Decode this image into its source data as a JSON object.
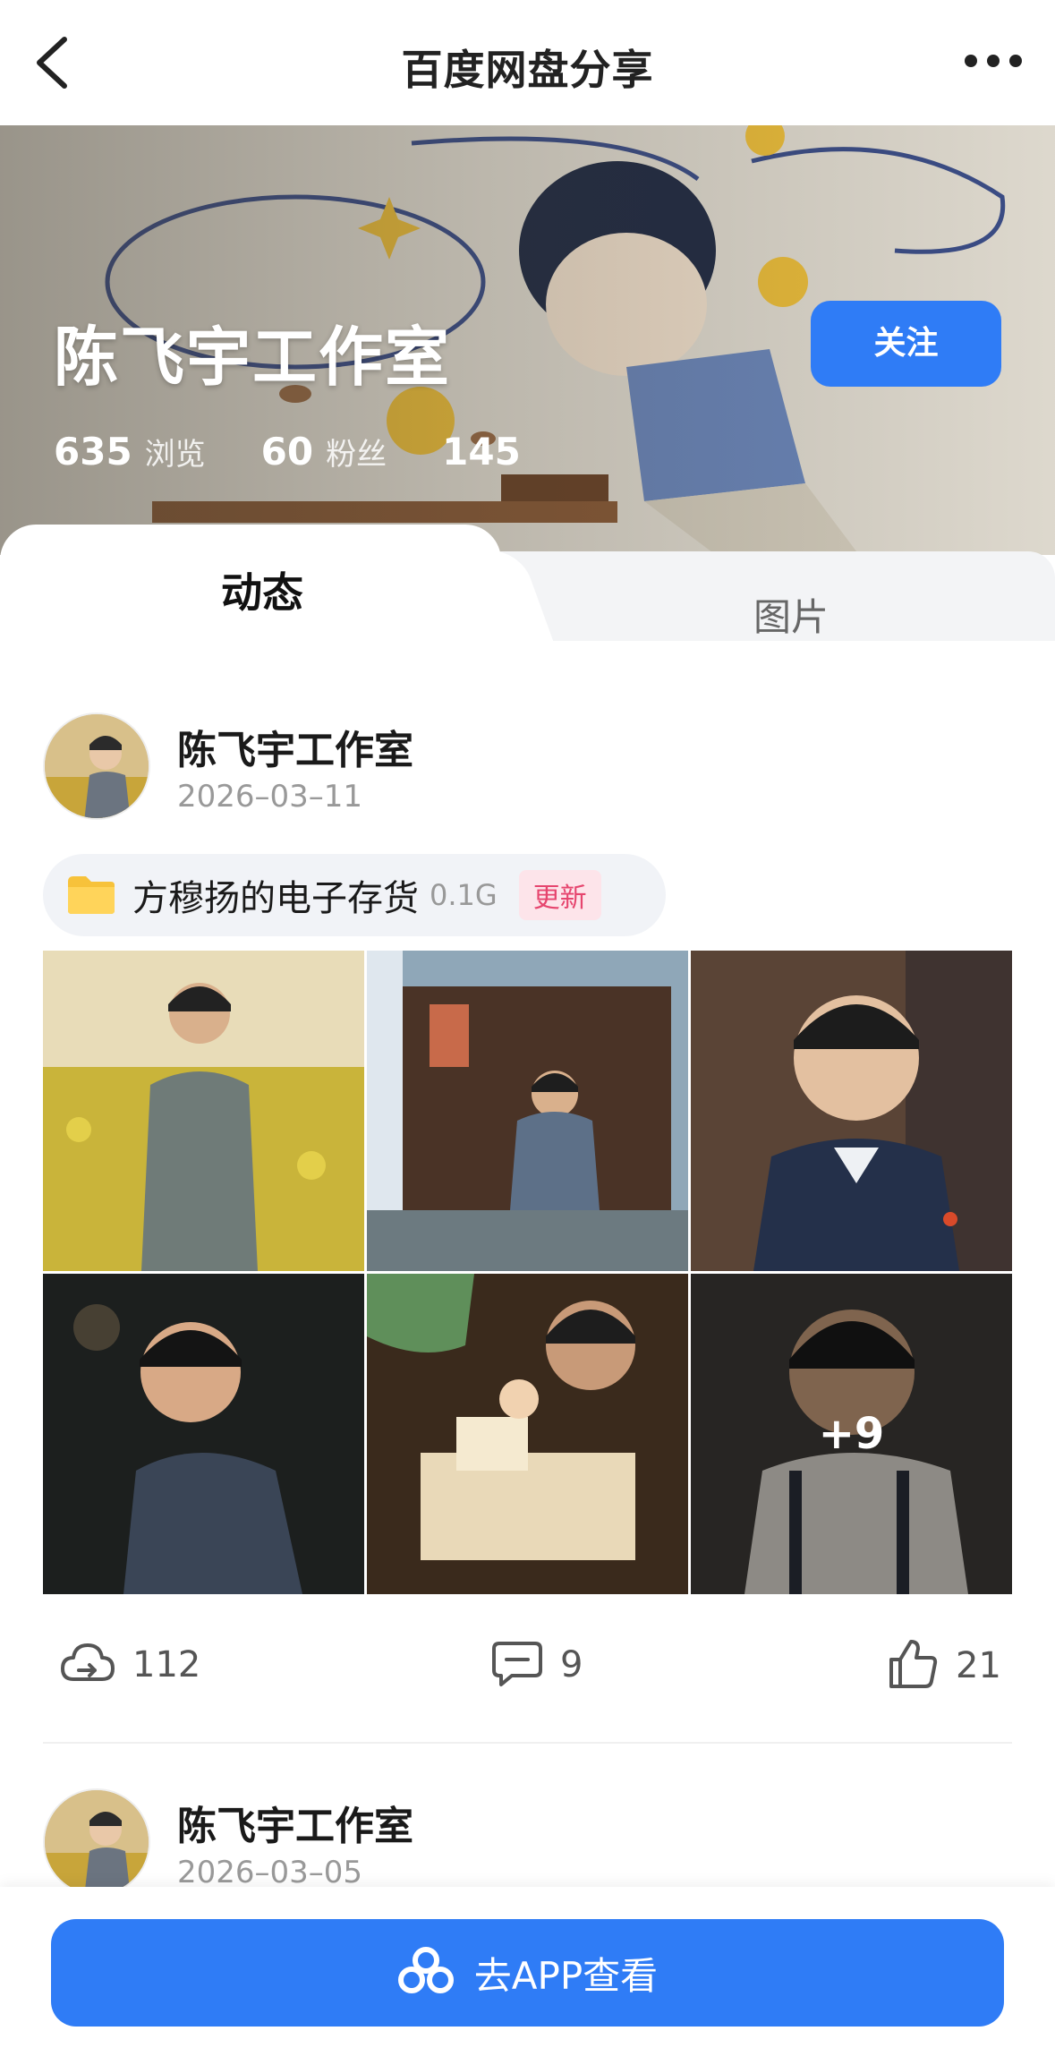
{
  "nav": {
    "title": "百度网盘分享",
    "back_icon": "chevron-left-icon",
    "more_icon": "more-dots-icon"
  },
  "profile": {
    "name": "陈飞宇工作室",
    "follow_label": "关注",
    "stats": [
      {
        "value": "635",
        "label": "浏览"
      },
      {
        "value": "60",
        "label": "粉丝"
      },
      {
        "value": "145",
        "label": ""
      }
    ]
  },
  "tabs": [
    {
      "label": "动态",
      "active": true
    },
    {
      "label": "图片",
      "active": false
    }
  ],
  "posts": [
    {
      "author": "陈飞宇工作室",
      "date": "2026–03–11",
      "file": {
        "name": "方穆扬的电子存货",
        "size": "0.1G",
        "badge": "更新",
        "icon": "folder-icon"
      },
      "photos": [
        {
          "desc": "yellow-field-portrait"
        },
        {
          "desc": "window-lantern-portrait"
        },
        {
          "desc": "smiling-portrait"
        },
        {
          "desc": "dark-portrait"
        },
        {
          "desc": "workbench-portrait"
        },
        {
          "desc": "apron-portrait",
          "more": "+9"
        }
      ],
      "actions": {
        "saves": "112",
        "comments": "9",
        "likes": "21"
      }
    },
    {
      "author": "陈飞宇工作室",
      "date": "2026–03–05"
    }
  ],
  "cta": {
    "label": "去APP查看",
    "icon": "baidu-netdisk-icon"
  },
  "colors": {
    "accent": "#2f7cf6",
    "badge_bg": "#fde4ea",
    "badge_text": "#e6456e"
  }
}
